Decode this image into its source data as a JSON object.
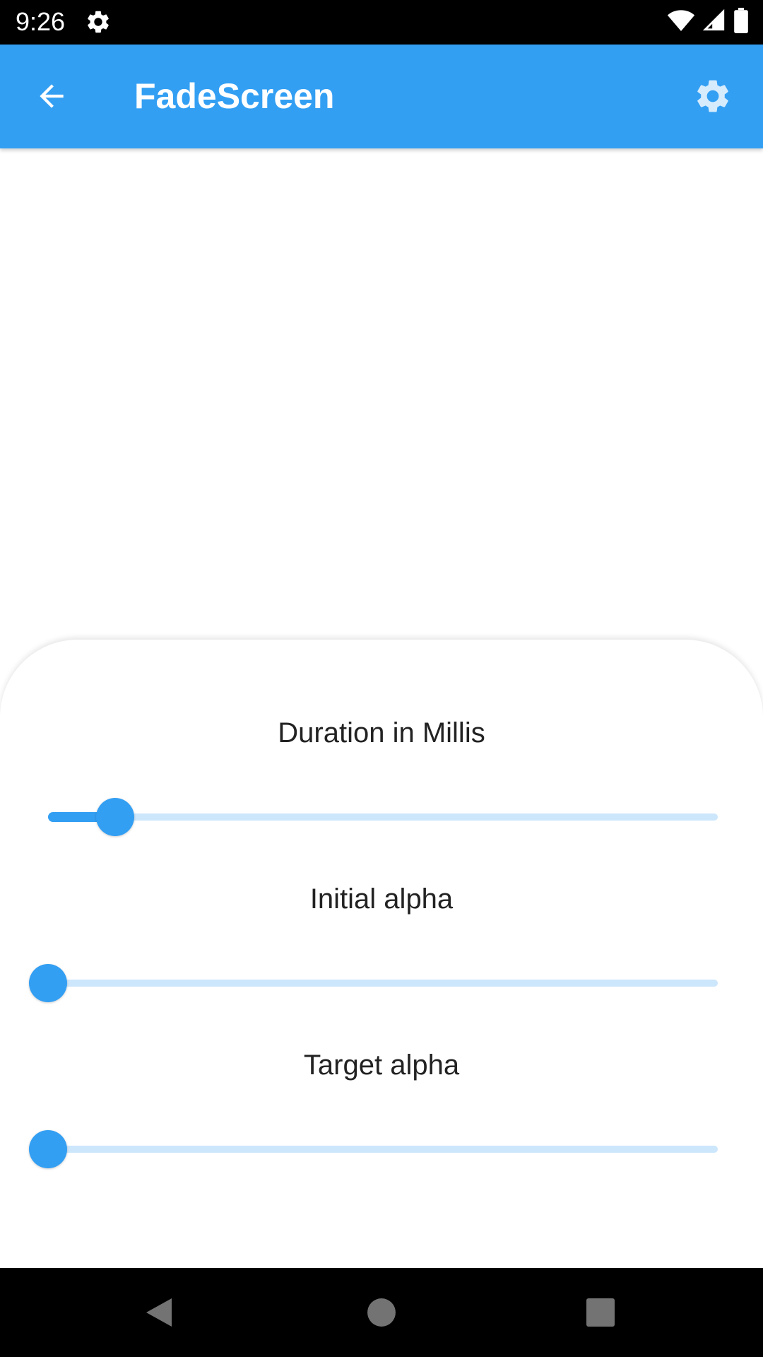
{
  "status_bar": {
    "time": "9:26",
    "icons": [
      "settings-icon",
      "wifi-icon",
      "signal-icon",
      "battery-icon"
    ]
  },
  "app_bar": {
    "title": "FadeScreen",
    "back_icon": "arrow-back-icon",
    "settings_icon": "settings-icon",
    "color": "#339ff3"
  },
  "sliders": [
    {
      "label": "Duration in Millis",
      "value_fraction": 0.1
    },
    {
      "label": "Initial alpha",
      "value_fraction": 0.0
    },
    {
      "label": "Target alpha",
      "value_fraction": 0.0
    }
  ],
  "colors": {
    "accent": "#339ff3",
    "track_inactive": "#cce6fb"
  },
  "nav_bar": {
    "buttons": [
      "back-triangle-icon",
      "home-circle-icon",
      "recents-square-icon"
    ]
  }
}
